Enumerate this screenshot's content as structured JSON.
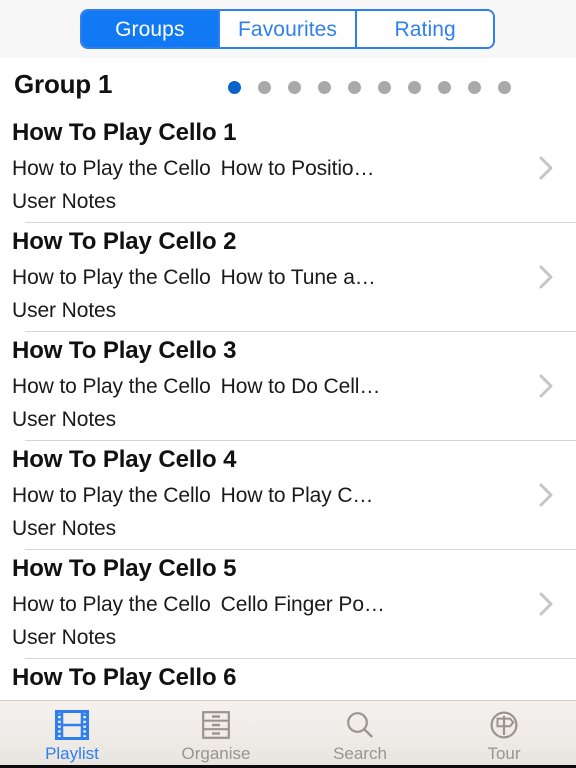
{
  "segmented_control": {
    "name": "view-mode-segmented-control",
    "selected": "Groups",
    "options": [
      {
        "label": "Groups",
        "active": true
      },
      {
        "label": "Favourites",
        "active": false
      },
      {
        "label": "Rating",
        "active": false
      }
    ],
    "accent_color": "#1179f3",
    "border_color": "#2f7ff0"
  },
  "group_header": {
    "title": "Group 1",
    "page_dots": {
      "total": 10,
      "current_index": 1,
      "active_color": "#0b63c9",
      "inactive_color": "#a9a9a9"
    }
  },
  "list": {
    "rows": [
      {
        "title": "How To Play Cello 1",
        "source": "How to Play the Cello",
        "detail": "How to Positio…",
        "notes": "User Notes",
        "accessory": "chevron-right"
      },
      {
        "title": "How To Play Cello 2",
        "source": "How to Play the Cello",
        "detail": "How to Tune a…",
        "notes": "User Notes",
        "accessory": "chevron-right"
      },
      {
        "title": "How To Play Cello 3",
        "source": "How to Play the Cello",
        "detail": "How to Do Cell…",
        "notes": "User Notes",
        "accessory": "chevron-right"
      },
      {
        "title": "How To Play Cello 4",
        "source": "How to Play the Cello",
        "detail": "How to Play C…",
        "notes": "User Notes",
        "accessory": "chevron-right"
      },
      {
        "title": "How To Play Cello 5",
        "source": "How to Play the Cello",
        "detail": "Cello Finger Po…",
        "notes": "User Notes",
        "accessory": "chevron-right"
      },
      {
        "title": "How To Play Cello 6",
        "source": "",
        "detail": "",
        "notes": "",
        "accessory": ""
      }
    ]
  },
  "tabbar": {
    "active_color": "#2f7ff0",
    "inactive_color": "#9a948f",
    "tabs": [
      {
        "label": "Playlist",
        "icon": "film-strip-icon",
        "active": true
      },
      {
        "label": "Organise",
        "icon": "drawers-icon",
        "active": false
      },
      {
        "label": "Search",
        "icon": "magnifier-icon",
        "active": false
      },
      {
        "label": "Tour",
        "icon": "signpost-circle-icon",
        "active": false
      }
    ]
  }
}
